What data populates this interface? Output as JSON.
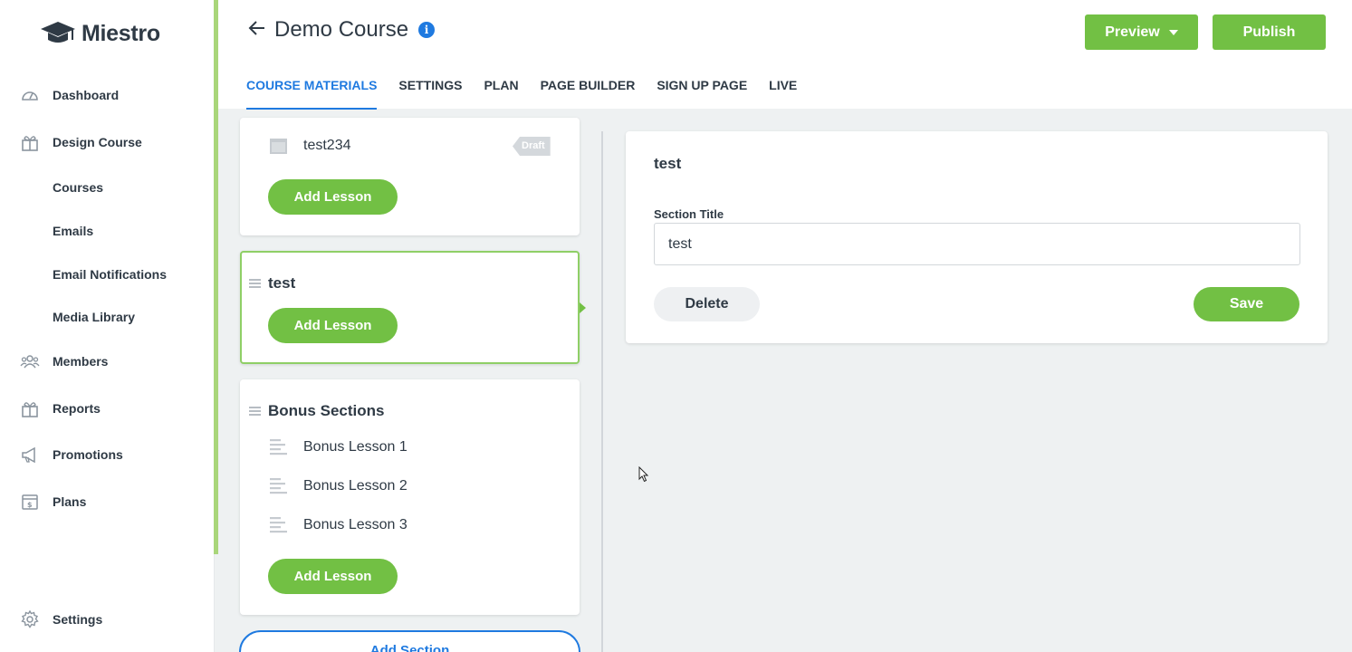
{
  "app": {
    "name": "Miestro"
  },
  "sidebar": {
    "items": [
      {
        "label": "Dashboard",
        "icon": "dashboard-icon"
      },
      {
        "label": "Design Course",
        "icon": "design-course-icon"
      },
      {
        "label": "Courses"
      },
      {
        "label": "Emails"
      },
      {
        "label": "Email Notifications"
      },
      {
        "label": "Media Library"
      },
      {
        "label": "Members",
        "icon": "members-icon"
      },
      {
        "label": "Reports",
        "icon": "reports-icon"
      },
      {
        "label": "Promotions",
        "icon": "megaphone-icon"
      },
      {
        "label": "Plans",
        "icon": "plans-icon"
      },
      {
        "label": "Settings",
        "icon": "gear-icon"
      }
    ]
  },
  "header": {
    "title": "Demo Course",
    "preview_label": "Preview",
    "publish_label": "Publish",
    "tabs": [
      {
        "label": "COURSE MATERIALS",
        "active": true
      },
      {
        "label": "SETTINGS"
      },
      {
        "label": "PLAN"
      },
      {
        "label": "PAGE BUILDER"
      },
      {
        "label": "SIGN UP PAGE"
      },
      {
        "label": "LIVE"
      }
    ]
  },
  "sections": [
    {
      "lessons": [
        {
          "label": "test234",
          "badge": "Draft"
        }
      ],
      "add_lesson_label": "Add Lesson"
    },
    {
      "title": "test",
      "add_lesson_label": "Add Lesson"
    },
    {
      "title": "Bonus Sections",
      "lessons": [
        {
          "label": "Bonus Lesson 1"
        },
        {
          "label": "Bonus Lesson 2"
        },
        {
          "label": "Bonus Lesson 3"
        }
      ],
      "add_lesson_label": "Add Lesson"
    }
  ],
  "add_section_label": "Add Section",
  "editor": {
    "heading": "test",
    "field_label": "Section Title",
    "field_value": "test",
    "delete_label": "Delete",
    "save_label": "Save"
  },
  "colors": {
    "accent_green": "#72c044",
    "accent_blue": "#1f7ae0",
    "text": "#2f3a45"
  }
}
